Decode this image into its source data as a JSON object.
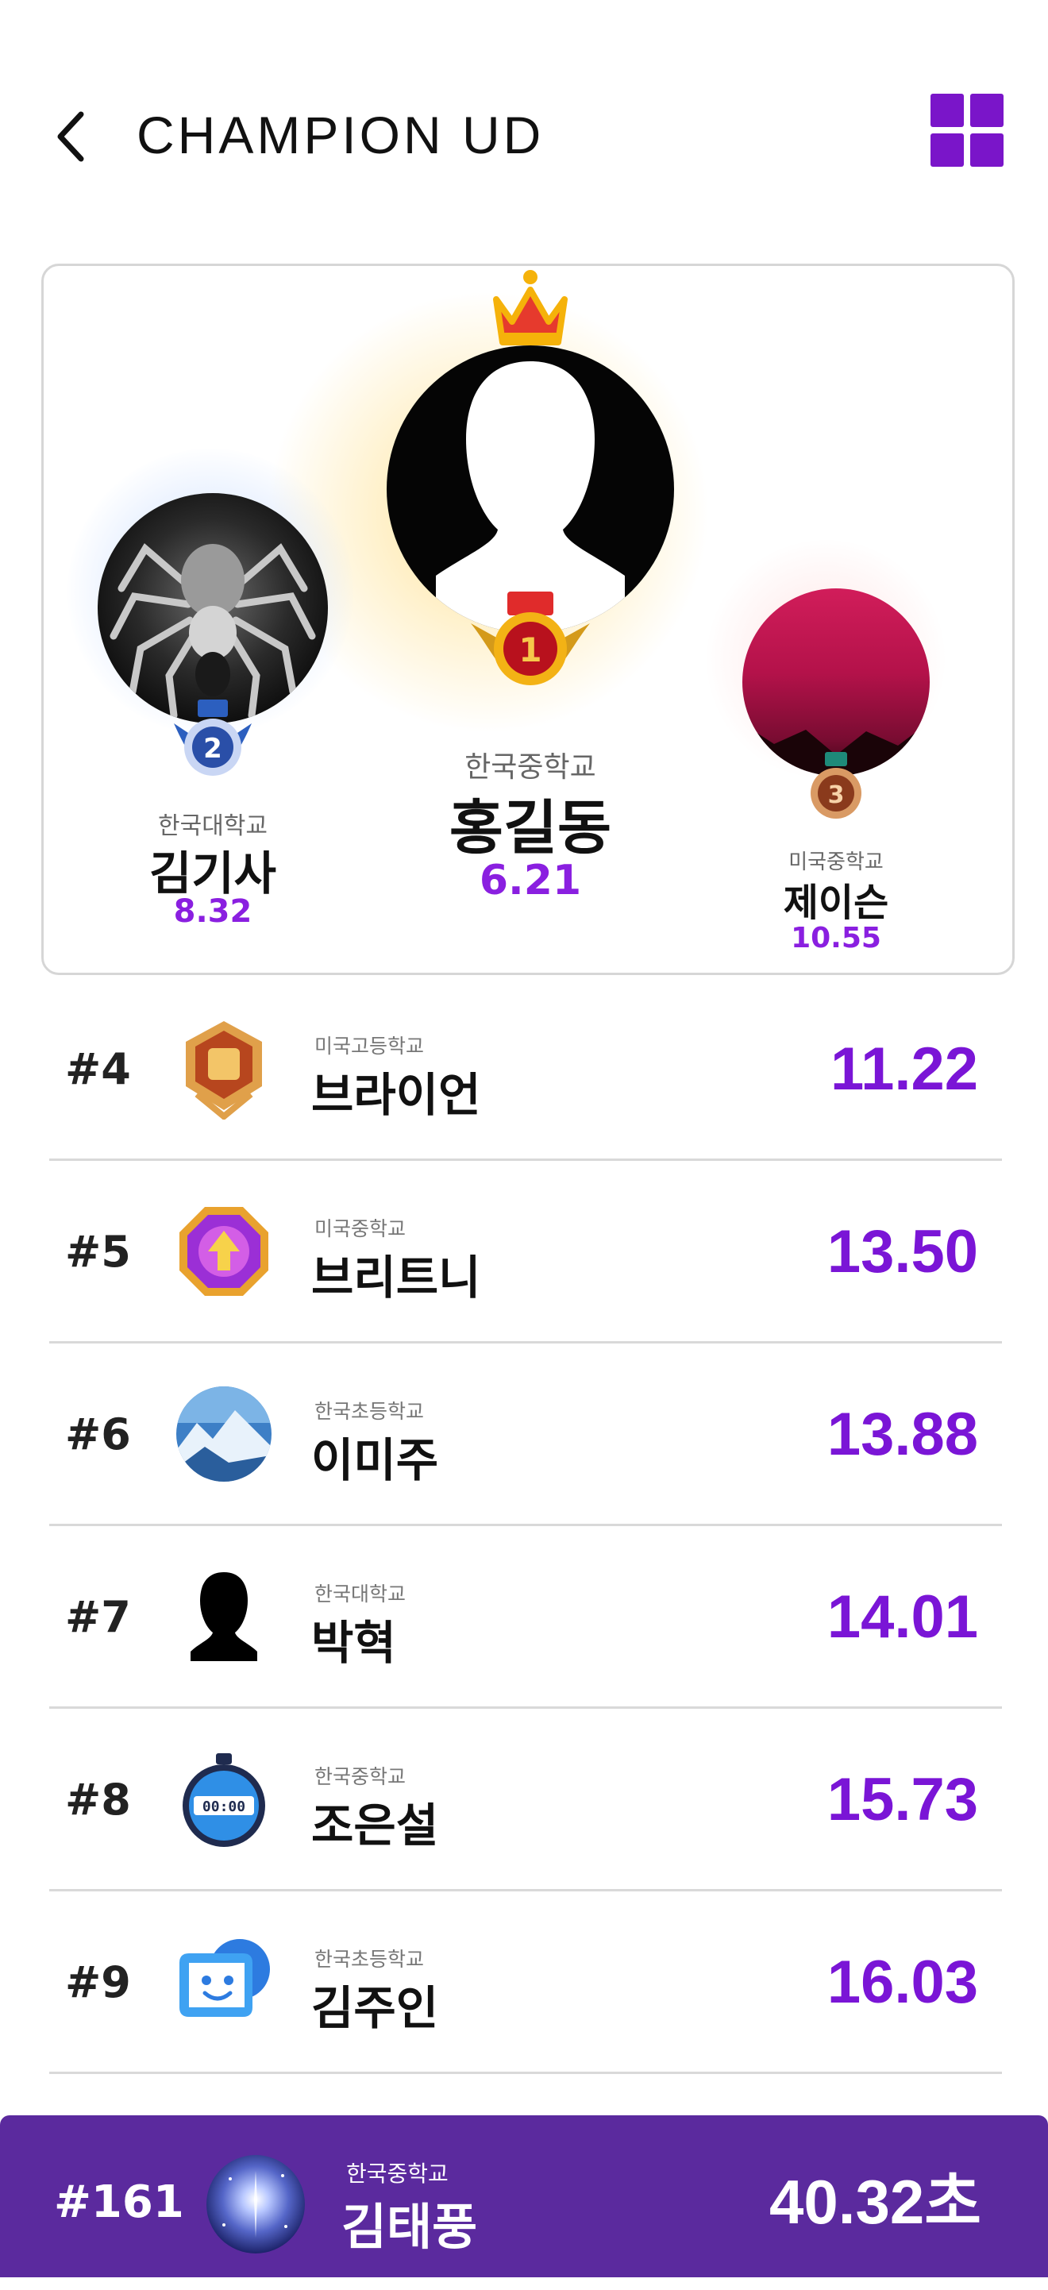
{
  "header": {
    "title": "CHAMPION UD",
    "back_icon": "chevron-left-icon",
    "menu_icon": "grid-menu-icon",
    "accent_color": "#7a15c9"
  },
  "podium": {
    "first": {
      "rank": "1",
      "school": "한국중학교",
      "name": "홍길동",
      "score": "6.21",
      "avatar": "person-silhouette",
      "medal": "gold-crown-medal"
    },
    "second": {
      "rank": "2",
      "school": "한국대학교",
      "name": "김기사",
      "score": "8.32",
      "avatar": "spider",
      "medal": "silver-medal"
    },
    "third": {
      "rank": "3",
      "school": "미국중학교",
      "name": "제이슨",
      "score": "10.55",
      "avatar": "sunset",
      "medal": "bronze-medal"
    }
  },
  "ranking": [
    {
      "rank": "#4",
      "school": "미국고등학교",
      "name": "브라이언",
      "score": "11.22",
      "icon": "gold-badge-icon"
    },
    {
      "rank": "#5",
      "school": "미국중학교",
      "name": "브리트니",
      "score": "13.50",
      "icon": "purple-badge-icon"
    },
    {
      "rank": "#6",
      "school": "한국초등학교",
      "name": "이미주",
      "score": "13.88",
      "icon": "mountain-avatar"
    },
    {
      "rank": "#7",
      "school": "한국대학교",
      "name": "박혁",
      "score": "14.01",
      "icon": "person-silhouette-icon"
    },
    {
      "rank": "#8",
      "school": "한국중학교",
      "name": "조은설",
      "score": "15.73",
      "icon": "stopwatch-icon"
    },
    {
      "rank": "#9",
      "school": "한국초등학교",
      "name": "김주인",
      "score": "16.03",
      "icon": "chat-bubble-icon"
    }
  ],
  "my_rank": {
    "rank": "#161",
    "school": "한국중학교",
    "name": "김태풍",
    "score": "40.32초",
    "avatar": "galaxy-avatar"
  },
  "colors": {
    "score_purple": "#7a15d6",
    "my_rank_bg": "#5b2a9e"
  }
}
